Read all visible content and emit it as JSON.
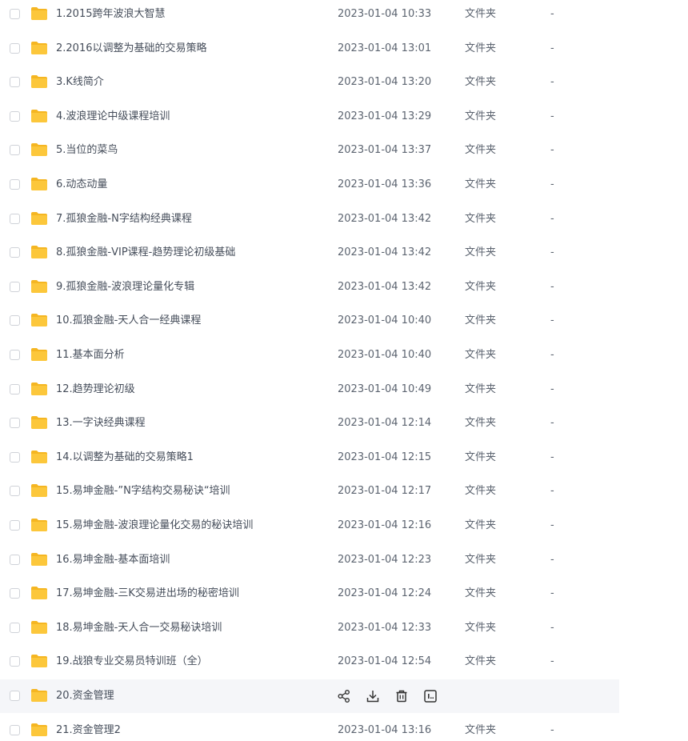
{
  "files": [
    {
      "name": "1.2015跨年波浪大智慧",
      "time": "2023-01-04 10:33",
      "type": "文件夹",
      "size": "-"
    },
    {
      "name": "2.2016以调整为基础的交易策略",
      "time": "2023-01-04 13:01",
      "type": "文件夹",
      "size": "-"
    },
    {
      "name": "3.K线简介",
      "time": "2023-01-04 13:20",
      "type": "文件夹",
      "size": "-"
    },
    {
      "name": "4.波浪理论中级课程培训",
      "time": "2023-01-04 13:29",
      "type": "文件夹",
      "size": "-"
    },
    {
      "name": "5.当位的菜鸟",
      "time": "2023-01-04 13:37",
      "type": "文件夹",
      "size": "-"
    },
    {
      "name": "6.动态动量",
      "time": "2023-01-04 13:36",
      "type": "文件夹",
      "size": "-"
    },
    {
      "name": "7.孤狼金融-N字结构经典课程",
      "time": "2023-01-04 13:42",
      "type": "文件夹",
      "size": "-"
    },
    {
      "name": "8.孤狼金融-VIP课程-趋势理论初级基础",
      "time": "2023-01-04 13:42",
      "type": "文件夹",
      "size": "-"
    },
    {
      "name": "9.孤狼金融-波浪理论量化专辑",
      "time": "2023-01-04 13:42",
      "type": "文件夹",
      "size": "-"
    },
    {
      "name": "10.孤狼金融-天人合一经典课程",
      "time": "2023-01-04 10:40",
      "type": "文件夹",
      "size": "-"
    },
    {
      "name": "11.基本面分析",
      "time": "2023-01-04 10:40",
      "type": "文件夹",
      "size": "-"
    },
    {
      "name": "12.趋势理论初级",
      "time": "2023-01-04 10:49",
      "type": "文件夹",
      "size": "-"
    },
    {
      "name": "13.一字诀经典课程",
      "time": "2023-01-04 12:14",
      "type": "文件夹",
      "size": "-"
    },
    {
      "name": "14.以调整为基础的交易策略1",
      "time": "2023-01-04 12:15",
      "type": "文件夹",
      "size": "-"
    },
    {
      "name": "15.易坤金融-”N字结构交易秘诀“培训",
      "time": "2023-01-04 12:17",
      "type": "文件夹",
      "size": "-"
    },
    {
      "name": "15.易坤金融-波浪理论量化交易的秘诀培训",
      "time": "2023-01-04 12:16",
      "type": "文件夹",
      "size": "-"
    },
    {
      "name": "16.易坤金融-基本面培训",
      "time": "2023-01-04 12:23",
      "type": "文件夹",
      "size": "-"
    },
    {
      "name": "17.易坤金融-三K交易进出场的秘密培训",
      "time": "2023-01-04 12:24",
      "type": "文件夹",
      "size": "-"
    },
    {
      "name": "18.易坤金融-天人合一交易秘诀培训",
      "time": "2023-01-04 12:33",
      "type": "文件夹",
      "size": "-"
    },
    {
      "name": "19.战狼专业交易员特训班（全）",
      "time": "2023-01-04 12:54",
      "type": "文件夹",
      "size": "-"
    },
    {
      "name": "20.资金管理",
      "time": "",
      "type": "",
      "size": "",
      "hovered": true
    },
    {
      "name": "21.资金管理2",
      "time": "2023-01-04 13:16",
      "type": "文件夹",
      "size": "-"
    }
  ],
  "hover_actions": [
    "share-icon",
    "download-icon",
    "delete-icon",
    "more-icon"
  ],
  "colors": {
    "folder": "#fcc73b",
    "folder_dark": "#f5b622",
    "hover_row": "#f5f6f9",
    "text": "#454d5a"
  }
}
